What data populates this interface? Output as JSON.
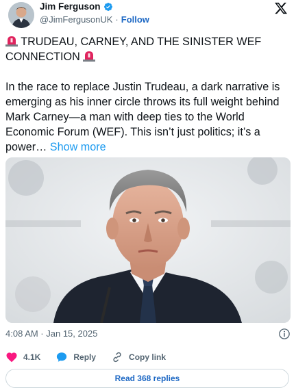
{
  "author": {
    "display_name": "Jim Ferguson",
    "handle": "@JimFergusonUK",
    "separator": "·",
    "follow_label": "Follow",
    "verified": true
  },
  "tweet": {
    "headline": "TRUDEAU, CARNEY, AND THE SINISTER WEF CONNECTION",
    "body": "In the race to replace Justin Trudeau, a dark narrative is emerging as his inner circle throws its full weight behind Mark Carney—a man with deep ties to the World Economic Forum (WEF). This isn’t just politics; it’s a power…",
    "show_more_label": "Show more",
    "timestamp": "4:08 AM · Jan 15, 2025"
  },
  "actions": {
    "likes": "4.1K",
    "reply_label": "Reply",
    "copy_link_label": "Copy link"
  },
  "read_replies_label": "Read 368 replies",
  "colors": {
    "link_blue": "#1d9bf0",
    "follow_blue": "#1d68c4",
    "like_pink": "#f91880",
    "muted_text": "#536471",
    "alarm_red": "#e0245e"
  },
  "icons": [
    "verified-badge-icon",
    "x-logo-icon",
    "rotating-light-icon",
    "info-icon",
    "heart-icon",
    "reply-bubble-icon",
    "link-icon"
  ]
}
